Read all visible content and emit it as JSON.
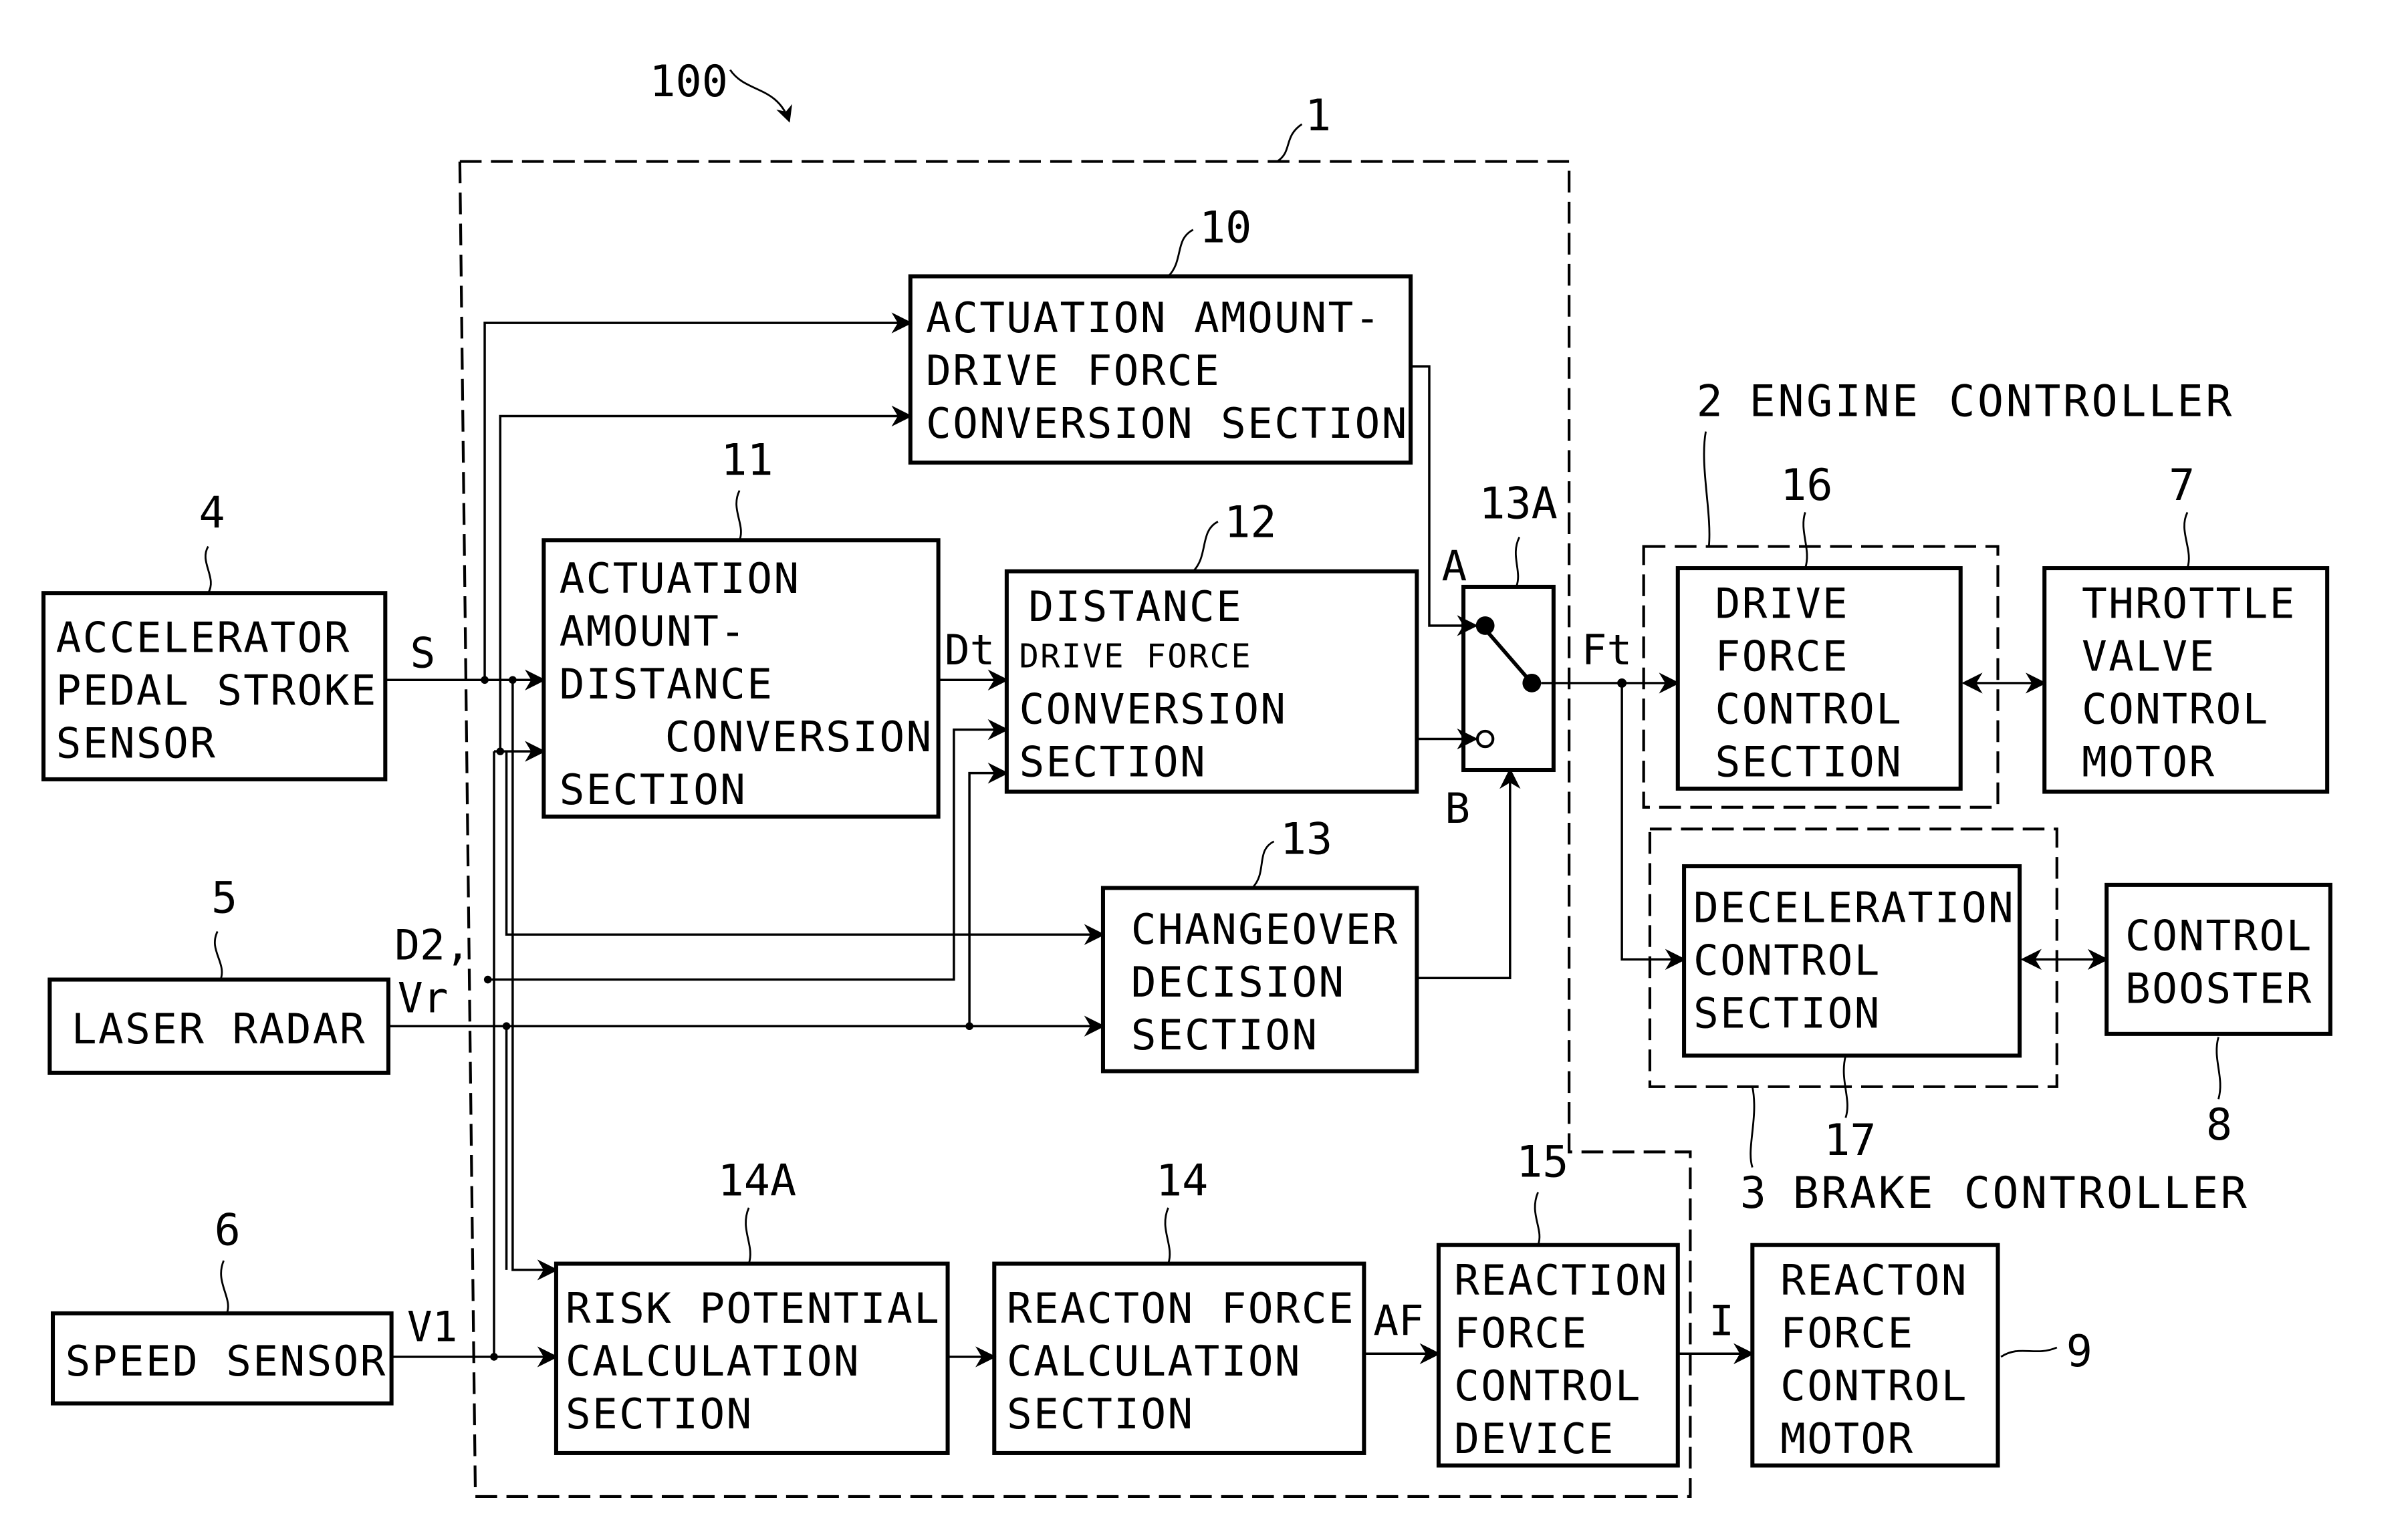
{
  "figure": {
    "system_ref": "100",
    "controller_ref": "1"
  },
  "blocks": {
    "accel_sensor": {
      "ref": "4",
      "lines": [
        "ACCELERATOR",
        "PEDAL STROKE",
        "SENSOR"
      ]
    },
    "laser_radar": {
      "ref": "5",
      "lines": [
        "LASER RADAR"
      ]
    },
    "speed_sensor": {
      "ref": "6",
      "lines": [
        "SPEED SENSOR"
      ]
    },
    "drive_force_conv": {
      "ref": "10",
      "lines": [
        "ACTUATION AMOUNT-",
        "DRIVE FORCE",
        "CONVERSION SECTION"
      ]
    },
    "distance_conv": {
      "ref": "11",
      "lines": [
        "ACTUATION",
        "AMOUNT-",
        "DISTANCE",
        "CONVERSION",
        "SECTION"
      ]
    },
    "distance_drive_conv": {
      "ref": "12",
      "lines": [
        "DISTANCE",
        "DRIVE FORCE",
        "CONVERSION",
        "SECTION"
      ]
    },
    "changeover": {
      "ref": "13",
      "lines": [
        "CHANGEOVER",
        "DECISION",
        "SECTION"
      ]
    },
    "switch": {
      "ref": "13A",
      "input_a": "A",
      "input_b": "B"
    },
    "risk_potential": {
      "ref": "14A",
      "lines": [
        "RISK POTENTIAL",
        "CALCULATION",
        "SECTION"
      ]
    },
    "reaction_calc": {
      "ref": "14",
      "lines": [
        "REACTON FORCE",
        "CALCULATION",
        "SECTION"
      ]
    },
    "reaction_device": {
      "ref": "15",
      "lines": [
        "REACTION",
        "FORCE",
        "CONTROL",
        "DEVICE"
      ]
    },
    "drive_force_ctrl": {
      "ref": "16",
      "lines": [
        "DRIVE",
        "FORCE",
        "CONTROL",
        "SECTION"
      ]
    },
    "throttle_motor": {
      "ref": "7",
      "lines": [
        "THROTTLE",
        "VALVE",
        "CONTROL",
        "MOTOR"
      ]
    },
    "decel_ctrl": {
      "ref": "17",
      "lines": [
        "DECELERATION",
        "CONTROL",
        "SECTION"
      ]
    },
    "control_booster": {
      "ref": "8",
      "lines": [
        "CONTROL",
        "BOOSTER"
      ]
    },
    "reaction_motor": {
      "ref": "9",
      "lines": [
        "REACTON",
        "FORCE",
        "CONTROL",
        "MOTOR"
      ]
    }
  },
  "groups": {
    "engine_controller": {
      "ref": "2",
      "label": "ENGINE CONTROLLER"
    },
    "brake_controller": {
      "ref": "3",
      "label": "BRAKE CONTROLLER"
    }
  },
  "signals": {
    "s": "S",
    "dt": "Dt",
    "d2": "D2,",
    "vr": "Vr",
    "v1": "V1",
    "ft": "Ft",
    "af": "AF",
    "i": "I"
  }
}
